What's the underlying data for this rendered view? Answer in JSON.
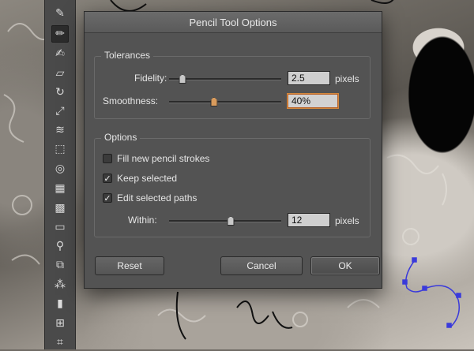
{
  "dialog": {
    "title": "Pencil Tool Options",
    "tolerances": {
      "title": "Tolerances",
      "fidelity": {
        "label": "Fidelity:",
        "value": "2.5",
        "unit": "pixels",
        "slider_fraction": 0.12
      },
      "smoothness": {
        "label": "Smoothness:",
        "value": "40%",
        "slider_fraction": 0.4
      }
    },
    "options": {
      "title": "Options",
      "fill_new": {
        "label": "Fill new pencil strokes",
        "checked": false
      },
      "keep_selected": {
        "label": "Keep selected",
        "checked": true
      },
      "edit_selected": {
        "label": "Edit selected paths",
        "checked": true
      },
      "within": {
        "label": "Within:",
        "value": "12",
        "unit": "pixels",
        "slider_fraction": 0.55
      }
    },
    "buttons": {
      "reset": "Reset",
      "cancel": "Cancel",
      "ok": "OK"
    }
  },
  "toolbar": {
    "tools": [
      "paintbrush-icon",
      "pencil-icon",
      "blob-brush-icon",
      "eraser-icon",
      "rotate-icon",
      "scale-icon",
      "width-icon",
      "free-transform-icon",
      "shape-builder-icon",
      "perspective-grid-icon",
      "mesh-icon",
      "gradient-icon",
      "eyedropper-icon",
      "blend-icon",
      "symbol-sprayer-icon",
      "column-graph-icon",
      "artboard-icon",
      "slice-icon"
    ],
    "active_tool": "pencil-icon"
  },
  "colors": {
    "dialog_bg": "#535353",
    "focus_ring": "#d4883c",
    "path_selection": "#3a3adb"
  }
}
